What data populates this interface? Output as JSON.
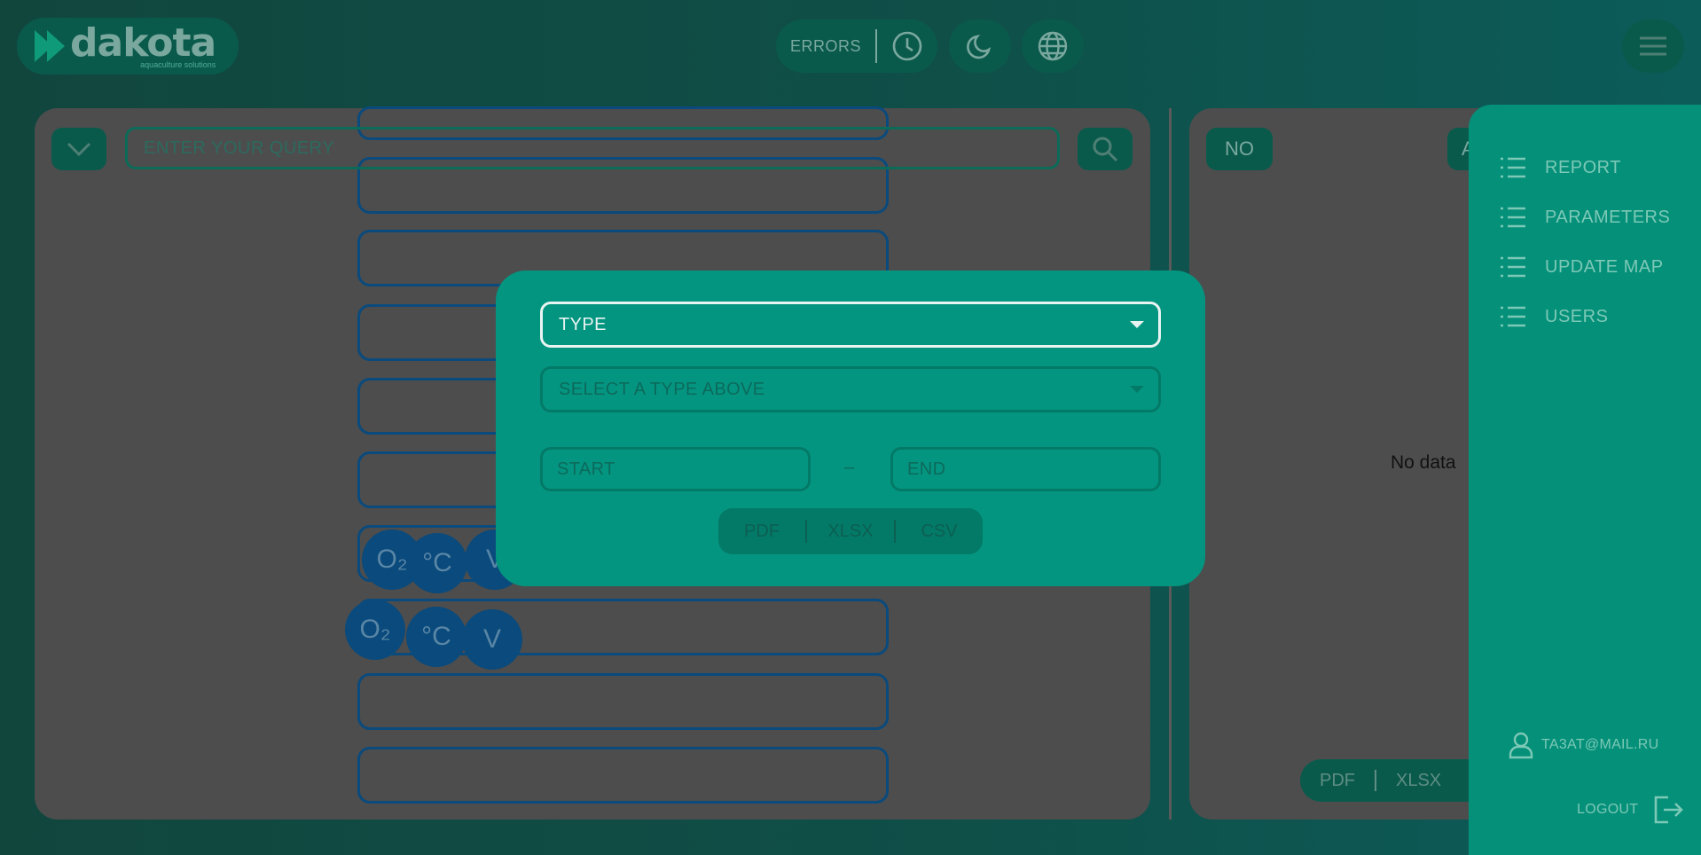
{
  "header": {
    "logo_word": "dakota",
    "logo_sub": "aquaculture solutions",
    "errors_label": "ERRORS"
  },
  "query": {
    "placeholder": "ENTER YOUR QUERY"
  },
  "badges": {
    "oxygen": "O₂",
    "temperature": "°C",
    "voltage": "V"
  },
  "right_panel": {
    "no_label": "NO",
    "a_label": "A",
    "empty_text": "No data",
    "export": [
      "PDF",
      "XLSX"
    ]
  },
  "side_menu": {
    "items": [
      "REPORT",
      "PARAMETERS",
      "UPDATE MAP",
      "USERS"
    ],
    "user_email": "TA3AT@MAIL.RU",
    "logout_label": "LOGOUT"
  },
  "modal": {
    "type_label": "TYPE",
    "subtype_label": "SELECT A TYPE ABOVE",
    "start_label": "START",
    "end_label": "END",
    "dash": "–",
    "export": [
      "PDF",
      "XLSX",
      "CSV"
    ]
  },
  "colors": {
    "accent": "#05907a",
    "modal_bg": "#049580",
    "card_border": "#0a4a7c"
  }
}
